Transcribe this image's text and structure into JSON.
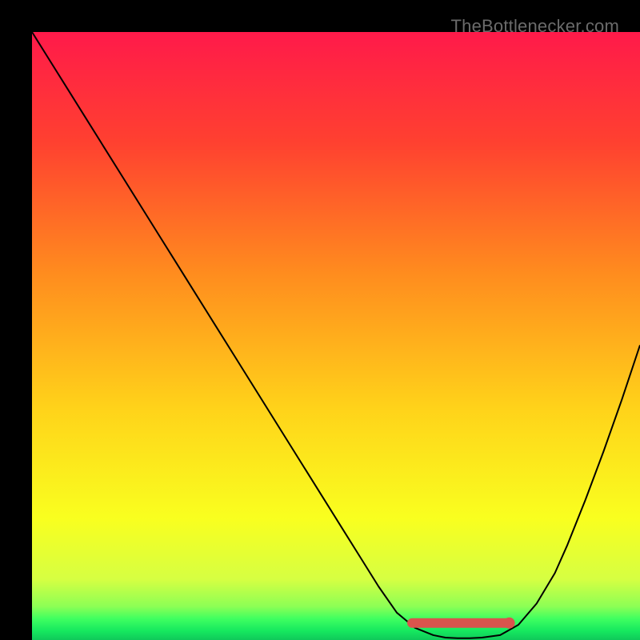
{
  "watermark": "TheBottlenecker.com",
  "chart_data": {
    "type": "line",
    "title": "",
    "xlabel": "",
    "ylabel": "",
    "xlim": [
      0,
      100
    ],
    "ylim": [
      0,
      100
    ],
    "background_gradient": {
      "stops": [
        {
          "offset": 0.0,
          "color": "#ff1a4a"
        },
        {
          "offset": 0.18,
          "color": "#ff4030"
        },
        {
          "offset": 0.4,
          "color": "#ff8d1e"
        },
        {
          "offset": 0.62,
          "color": "#ffd31a"
        },
        {
          "offset": 0.8,
          "color": "#f9ff1f"
        },
        {
          "offset": 0.9,
          "color": "#d6ff42"
        },
        {
          "offset": 0.945,
          "color": "#8cff55"
        },
        {
          "offset": 0.965,
          "color": "#3fff60"
        },
        {
          "offset": 0.985,
          "color": "#16e85f"
        },
        {
          "offset": 1.0,
          "color": "#0fc95a"
        }
      ]
    },
    "series": [
      {
        "name": "bottleneck-curve",
        "color": "#000000",
        "width": 2,
        "x": [
          0,
          3,
          6,
          9,
          12,
          15,
          18,
          21,
          24,
          27,
          30,
          33,
          36,
          39,
          42,
          45,
          48,
          51,
          54,
          57,
          60,
          63,
          66,
          68,
          70,
          72,
          74,
          77,
          80,
          83,
          86,
          88,
          91,
          94,
          97,
          100
        ],
        "y": [
          100.0,
          95.2,
          90.4,
          85.6,
          80.8,
          76.0,
          71.2,
          66.4,
          61.6,
          56.8,
          52.0,
          47.2,
          42.4,
          37.6,
          32.8,
          28.0,
          23.2,
          18.4,
          13.6,
          8.8,
          4.5,
          2.0,
          0.8,
          0.4,
          0.3,
          0.3,
          0.4,
          0.8,
          2.5,
          6.0,
          11.0,
          15.5,
          23.0,
          31.0,
          39.5,
          48.5
        ]
      },
      {
        "name": "optimal-band",
        "type": "marker-band",
        "color": "#d9544d",
        "y": 2.8,
        "x_start": 62.5,
        "x_end": 78.5,
        "thickness": 12,
        "end_radius": 7
      }
    ]
  }
}
